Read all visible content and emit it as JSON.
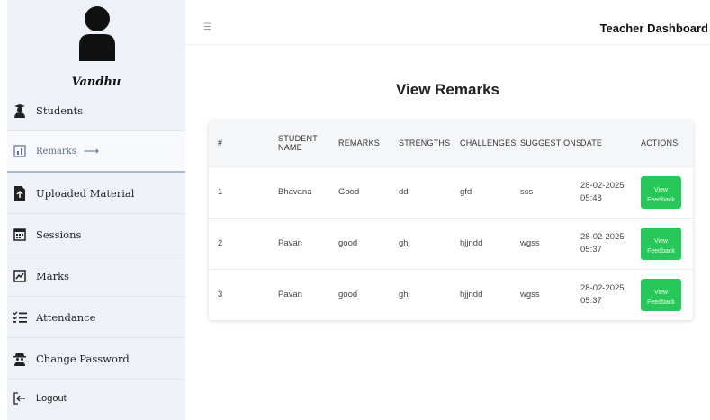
{
  "app": {
    "title": "Teacher Dashboard"
  },
  "user": {
    "name": "Vandhu"
  },
  "sidebar": {
    "items": [
      {
        "label": "Students",
        "icon": "student-icon"
      },
      {
        "label": "Remarks",
        "icon": "remarks-icon",
        "active": true
      },
      {
        "label": "Uploaded Material",
        "icon": "upload-file-icon"
      },
      {
        "label": "Sessions",
        "icon": "calendar-icon"
      },
      {
        "label": "Marks",
        "icon": "marks-icon"
      },
      {
        "label": "Attendance",
        "icon": "checklist-icon"
      },
      {
        "label": "Change Password",
        "icon": "spy-icon"
      },
      {
        "label": "Logout",
        "icon": "logout-icon"
      }
    ]
  },
  "main": {
    "heading": "View Remarks",
    "table": {
      "headers": [
        "#",
        "STUDENT NAME",
        "REMARKS",
        "STRENGTHS",
        "CHALLENGES",
        "SUGGESTIONS",
        "DATE",
        "ACTIONS"
      ],
      "rows": [
        {
          "num": "1",
          "student": "Bhavana",
          "remarks": "Good",
          "strengths": "dd",
          "challenges": "gfd",
          "suggestions": "sss",
          "date": "28-02-2025",
          "time": "05:48",
          "action": "View Feedback"
        },
        {
          "num": "2",
          "student": "Pavan",
          "remarks": "good",
          "strengths": "ghj",
          "challenges": "hjjndd",
          "suggestions": "wgss",
          "date": "28-02-2025",
          "time": "05:37",
          "action": "View Feedback"
        },
        {
          "num": "3",
          "student": "Pavan",
          "remarks": "good",
          "strengths": "ghj",
          "challenges": "hjjndd",
          "suggestions": "wgss",
          "date": "28-02-2025",
          "time": "05:37",
          "action": "View Feedback"
        }
      ]
    }
  },
  "colors": {
    "accent": "#27c75a",
    "sidebar_bg": "#eef1f7",
    "active_text": "#5a6e8a"
  }
}
